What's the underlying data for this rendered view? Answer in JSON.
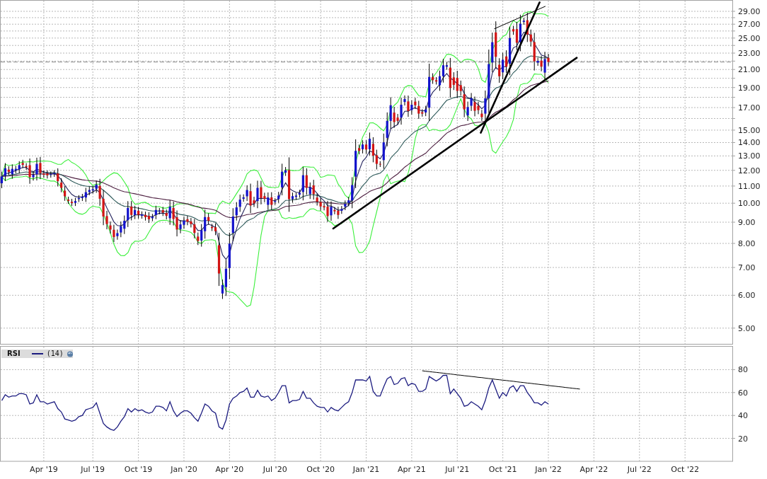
{
  "price_panel": {
    "y_axis_labels": [
      "29.00",
      "27.00",
      "25.00",
      "23.00",
      "21.00",
      "19.00",
      "17.00",
      "15.00",
      "14.00",
      "13.00",
      "12.00",
      "11.00",
      "10.00",
      "9.00",
      "8.00",
      "7.00",
      "6.00",
      "5.00"
    ]
  },
  "rsi_panel": {
    "legend": {
      "parameter": "(14)"
    },
    "chart_data": {
      "type": "line",
      "grid": true,
      "ylim": [
        0,
        100
      ],
      "yticks": [
        80,
        60,
        40,
        20
      ],
      "categories": [
        null,
        null,
        null,
        null,
        null,
        null,
        null,
        null,
        null,
        null,
        null,
        null,
        "Apr '19",
        null,
        null,
        null,
        null,
        null,
        null,
        null,
        null,
        null,
        null,
        null,
        null,
        null,
        "Jul '19",
        null,
        null,
        null,
        null,
        null,
        null,
        null,
        null,
        null,
        null,
        null,
        null,
        "Oct '19",
        null,
        null,
        null,
        null,
        null,
        null,
        null,
        null,
        null,
        null,
        null,
        null,
        "Jan '20",
        null,
        null,
        null,
        null,
        null,
        null,
        null,
        null,
        null,
        null,
        null,
        null,
        "Apr '20",
        null,
        null,
        null,
        null,
        null,
        null,
        null,
        null,
        null,
        null,
        null,
        null,
        "Jul '20",
        null,
        null,
        null,
        null,
        null,
        null,
        null,
        null,
        null,
        null,
        null,
        null,
        "Oct '20",
        null,
        null,
        null,
        null,
        null,
        null,
        null,
        null,
        null,
        null,
        null,
        null,
        "Jan '21",
        null,
        null,
        null,
        null,
        null,
        null,
        null,
        null,
        null,
        null,
        null,
        null,
        "Apr '21",
        null,
        null,
        null,
        null,
        null,
        null,
        null,
        null,
        null,
        null,
        null,
        null,
        "Jul '21",
        null,
        null,
        null,
        null,
        null,
        null,
        null,
        null,
        null,
        null,
        null,
        null,
        "Oct '21",
        null,
        null,
        null,
        null,
        null,
        null,
        null,
        null,
        null,
        null,
        null,
        null,
        "Jan '22",
        null,
        null,
        null,
        null,
        null,
        null,
        null,
        null,
        null,
        null,
        null,
        null,
        "Apr '22",
        null,
        null,
        null,
        null,
        null,
        null,
        null,
        null,
        null,
        null,
        null,
        null,
        "Jul '22",
        null,
        null,
        null,
        null,
        null,
        null,
        null,
        null,
        null,
        null,
        null,
        null,
        "Oct '22",
        null,
        null,
        null,
        null,
        null,
        null,
        null,
        null,
        null,
        null,
        null,
        null,
        null
      ],
      "series": [
        {
          "name": "RSI",
          "color": "#1c1c80",
          "values": [
            53,
            58,
            56,
            57,
            57,
            59,
            59,
            58,
            50,
            51,
            58,
            52,
            52,
            50,
            51,
            52,
            46,
            43,
            37,
            36,
            35,
            36,
            39,
            40,
            45,
            46,
            47,
            51,
            42,
            33,
            30,
            28,
            27,
            30,
            35,
            39,
            46,
            43,
            46,
            44,
            45,
            43,
            42,
            43,
            48,
            48,
            47,
            44,
            52,
            44,
            39,
            42,
            44,
            44,
            42,
            38,
            35,
            42,
            50,
            48,
            44,
            42,
            30,
            28,
            36,
            50,
            55,
            57,
            60,
            61,
            64,
            56,
            56,
            62,
            57,
            56,
            57,
            53,
            55,
            60,
            66,
            66,
            51,
            53,
            53,
            54,
            61,
            55,
            55,
            51,
            48,
            47,
            47,
            43,
            47,
            45,
            44,
            47,
            50,
            52,
            60,
            71,
            71,
            71,
            70,
            74,
            61,
            57,
            57,
            65,
            72,
            74,
            67,
            68,
            72,
            73,
            66,
            68,
            67,
            61,
            61,
            63,
            74,
            72,
            70,
            72,
            75,
            75,
            59,
            63,
            59,
            55,
            48,
            49,
            52,
            50,
            48,
            45,
            53,
            64,
            71,
            63,
            55,
            60,
            57,
            64,
            66,
            61,
            66,
            66,
            60,
            56,
            51,
            51,
            49,
            52,
            50,
            null,
            null,
            null,
            null,
            null,
            null,
            null,
            null,
            null,
            null,
            null,
            null,
            null,
            null,
            null,
            null,
            null,
            null,
            null,
            null,
            null,
            null,
            null,
            null,
            null,
            null,
            null,
            null,
            null,
            null,
            null,
            null,
            null,
            null,
            null,
            null,
            null,
            null,
            null,
            null,
            null,
            null,
            null,
            null,
            null,
            null,
            null,
            null,
            null,
            null,
            null,
            null
          ]
        },
        {
          "color": "#000000",
          "values": [
            null,
            null,
            null,
            null,
            null,
            null,
            null,
            null,
            null,
            null,
            null,
            null,
            null,
            null,
            null,
            null,
            null,
            null,
            null,
            null,
            null,
            null,
            null,
            null,
            null,
            null,
            null,
            null,
            null,
            null,
            null,
            null,
            null,
            null,
            null,
            null,
            null,
            null,
            null,
            null,
            null,
            null,
            null,
            null,
            null,
            null,
            null,
            null,
            null,
            null,
            null,
            null,
            null,
            null,
            null,
            null,
            null,
            null,
            null,
            null,
            null,
            null,
            null,
            null,
            null,
            null,
            null,
            null,
            null,
            null,
            null,
            null,
            null,
            null,
            null,
            null,
            null,
            null,
            null,
            null,
            null,
            null,
            null,
            null,
            null,
            null,
            null,
            null,
            null,
            null,
            null,
            null,
            null,
            null,
            null,
            null,
            null,
            null,
            null,
            null,
            null,
            null,
            null,
            null,
            null,
            null,
            null,
            null,
            null,
            null,
            null,
            null,
            null,
            null,
            null,
            null,
            null,
            null,
            null,
            null,
            79.0,
            78.6,
            78.3,
            77.9,
            77.6,
            77.2,
            76.9,
            76.5,
            76.2,
            75.8,
            75.4,
            75.1,
            74.7,
            74.4,
            74.0,
            73.7,
            73.3,
            73.0,
            72.6,
            72.2,
            71.9,
            71.5,
            71.2,
            70.8,
            70.5,
            70.1,
            69.8,
            69.4,
            69.0,
            68.7,
            68.3,
            68.0,
            67.6,
            67.3,
            66.9,
            66.6,
            66.2,
            65.8,
            65.5,
            65.1,
            64.8,
            64.4,
            64.1,
            63.7,
            63.4,
            63.0,
            null,
            null,
            null,
            null,
            null,
            null,
            null,
            null,
            null,
            null,
            null,
            null,
            null,
            null,
            null,
            null,
            null,
            null,
            null,
            null,
            null,
            null,
            null,
            null,
            null,
            null,
            null,
            null,
            null,
            null,
            null,
            null,
            null,
            null,
            null,
            null,
            null,
            null,
            null,
            null,
            null,
            null,
            null
          ]
        }
      ]
    }
  }
}
